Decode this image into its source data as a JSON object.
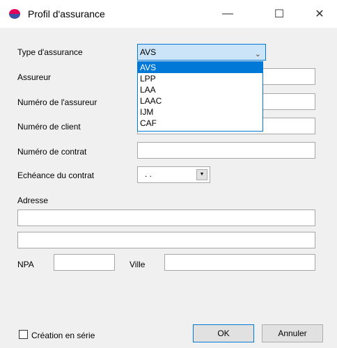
{
  "window": {
    "title": "Profil d'assurance",
    "minimize": "—",
    "maximize": "☐",
    "close": "✕"
  },
  "form": {
    "type_label": "Type d'assurance",
    "type_value": "AVS",
    "type_options": [
      "AVS",
      "LPP",
      "LAA",
      "LAAC",
      "IJM",
      "CAF"
    ],
    "insurer_label": "Assureur",
    "insurer_number_label": "Numéro de l'assureur",
    "client_number_label": "Numéro de client",
    "contract_number_label": "Numéro de contrat",
    "contract_due_label": "Echéance du contrat",
    "contract_due_value": ". .",
    "address_label": "Adresse",
    "npa_label": "NPA",
    "city_label": "Ville"
  },
  "footer": {
    "serial_label": "Création en série",
    "ok_label": "OK",
    "cancel_label": "Annuler"
  },
  "colors": {
    "accent": "#0078d7",
    "selection_bg": "#cce4f7",
    "window_bg": "#f0f0f0"
  }
}
